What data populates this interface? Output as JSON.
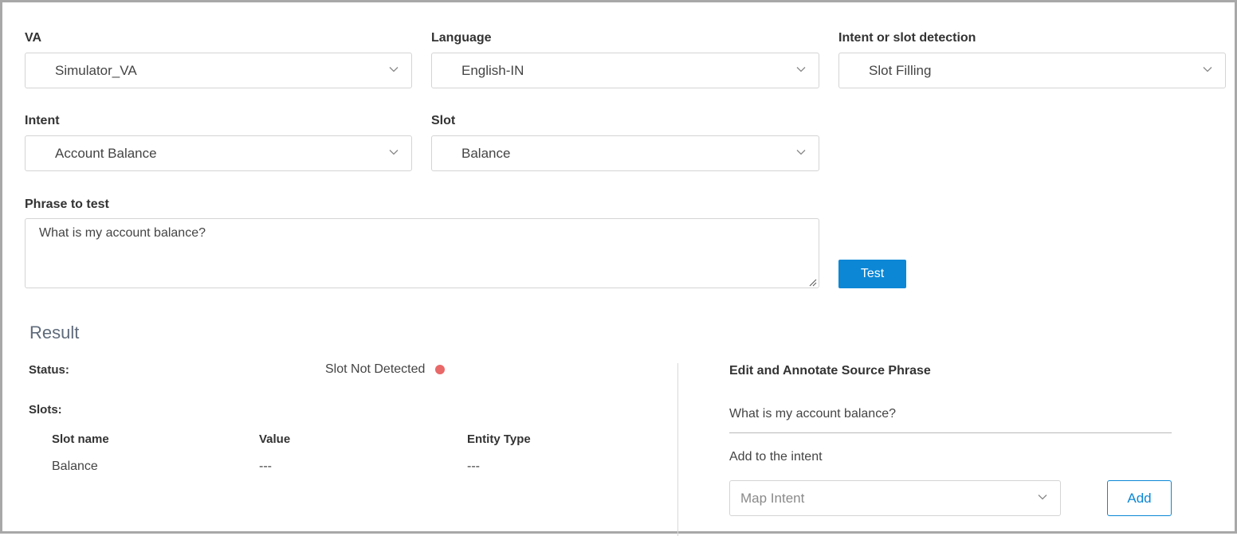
{
  "filters": {
    "va": {
      "label": "VA",
      "value": "Simulator_VA"
    },
    "language": {
      "label": "Language",
      "value": "English-IN"
    },
    "detection": {
      "label": "Intent or slot detection",
      "value": "Slot Filling"
    },
    "intent": {
      "label": "Intent",
      "value": "Account Balance"
    },
    "slot": {
      "label": "Slot",
      "value": "Balance"
    }
  },
  "phrase": {
    "label": "Phrase to test",
    "value": "What is my account balance?"
  },
  "test_button": "Test",
  "result": {
    "title": "Result",
    "status_label": "Status:",
    "status_value": "Slot Not Detected",
    "status_color": "#e96868",
    "slots_label": "Slots:",
    "table": {
      "headers": [
        "Slot name",
        "Value",
        "Entity Type"
      ],
      "rows": [
        [
          "Balance",
          "---",
          "---"
        ]
      ]
    }
  },
  "annotate": {
    "title": "Edit and Annotate Source Phrase",
    "phrase": "What is my account balance?",
    "add_label": "Add to the intent",
    "map_placeholder": "Map Intent",
    "add_button": "Add"
  },
  "colors": {
    "accent": "#0b87d6"
  }
}
